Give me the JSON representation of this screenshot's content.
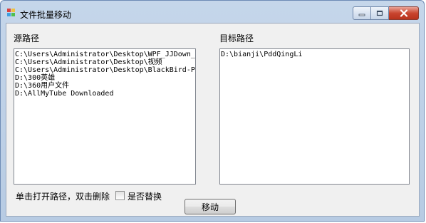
{
  "window": {
    "title": "文件批量移动",
    "icon": "app-icon",
    "controls": [
      "minimize-icon",
      "maximize-icon",
      "close-icon"
    ]
  },
  "source": {
    "label": "源路径",
    "items": [
      "C:\\Users\\Administrator\\Desktop\\WPF_JJDown_v",
      "C:\\Users\\Administrator\\Desktop\\视频",
      "C:\\Users\\Administrator\\Desktop\\BlackBird-Pl",
      "D:\\300英雄",
      "D:\\360用户文件",
      "D:\\AllMyTube Downloaded"
    ]
  },
  "target": {
    "label": "目标路径",
    "items": [
      "D:\\bianji\\PddQingLi"
    ]
  },
  "hint": "单击打开路径，双击删除",
  "replace_checkbox": {
    "label": "是否替换",
    "checked": false
  },
  "move_button": "移动",
  "colors": {
    "close": "#c9452f",
    "titlebar": "#c5d6ea",
    "client": "#f0f0f0"
  }
}
